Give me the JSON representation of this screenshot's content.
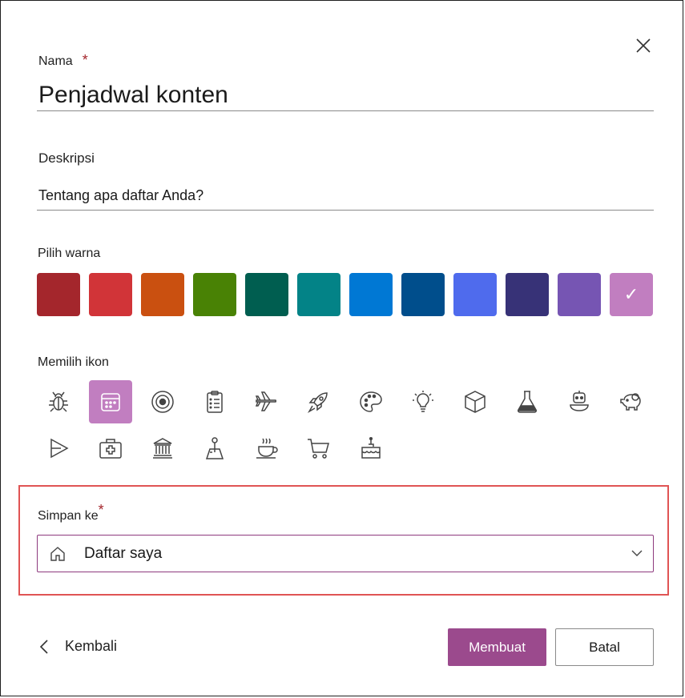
{
  "dialog": {
    "name_label": "Nama",
    "required_mark": "*",
    "name_value": "Penjadwal konten",
    "description_label": "Deskripsi",
    "description_placeholder": "Tentang apa daftar Anda?",
    "color_label": "Pilih warna",
    "icon_label": "Memilih ikon",
    "save_label": "Simpan ke",
    "save_value": "Daftar saya",
    "back_label": "Kembali",
    "create_label": "Membuat",
    "cancel_label": "Batal"
  },
  "colors": [
    "#a4262c",
    "#d13438",
    "#ca5010",
    "#498205",
    "#005e50",
    "#038387",
    "#0078d4",
    "#004e8c",
    "#4f6bed",
    "#373277",
    "#7655b3",
    "#c17ec0"
  ],
  "selected_color": "#c17ec0",
  "selected_color_check": "✓",
  "icons_row1": [
    "bug-icon",
    "calendar-icon",
    "target-icon",
    "clipboard-icon",
    "airplane-icon",
    "rocket-icon",
    "palette-icon",
    "lightbulb-icon",
    "cube-icon",
    "flask-icon",
    "robot-icon",
    "piggy-bank-icon"
  ],
  "icons_row2": [
    "play-icon",
    "medical-kit-icon",
    "bank-icon",
    "joystick-icon",
    "coffee-icon",
    "cart-icon",
    "cake-icon"
  ],
  "selected_icon": "calendar-icon",
  "accent_color": "#9b4a8d"
}
